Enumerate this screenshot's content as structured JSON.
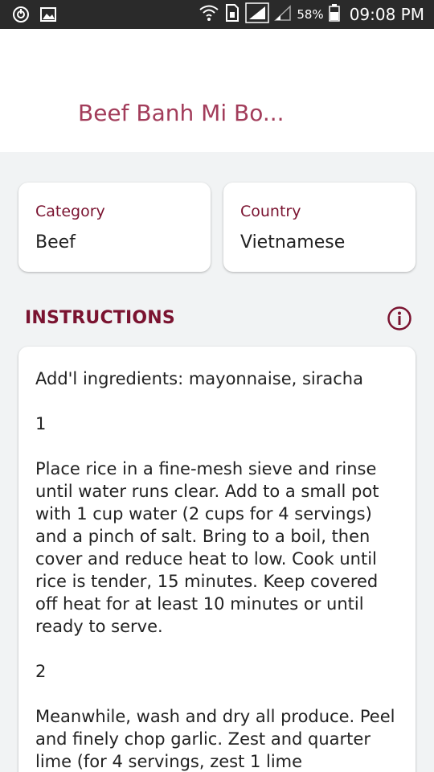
{
  "status_bar": {
    "battery_percent": "58%",
    "time": "09:08 PM"
  },
  "header": {
    "title": "Beef Banh Mi Bo..."
  },
  "info": {
    "category_label": "Category",
    "category_value": "Beef",
    "country_label": "Country",
    "country_value": "Vietnamese"
  },
  "instructions": {
    "section_title": "INSTRUCTIONS",
    "paragraphs": [
      "Add'l ingredients: mayonnaise, siracha",
      "1",
      "Place rice in a fine-mesh sieve and rinse until water runs clear. Add to a small pot with 1 cup water (2 cups for 4 servings) and a pinch of salt. Bring to a boil, then cover and reduce heat to low. Cook until rice is tender, 15 minutes. Keep covered off heat for at least 10 minutes or until ready to serve.",
      "2",
      "Meanwhile, wash and dry all produce. Peel and finely chop garlic. Zest and quarter lime (for 4 servings, zest 1 lime"
    ]
  },
  "colors": {
    "accent": "#7a1330",
    "title": "#a23c5a",
    "background": "#f1f3f4"
  }
}
